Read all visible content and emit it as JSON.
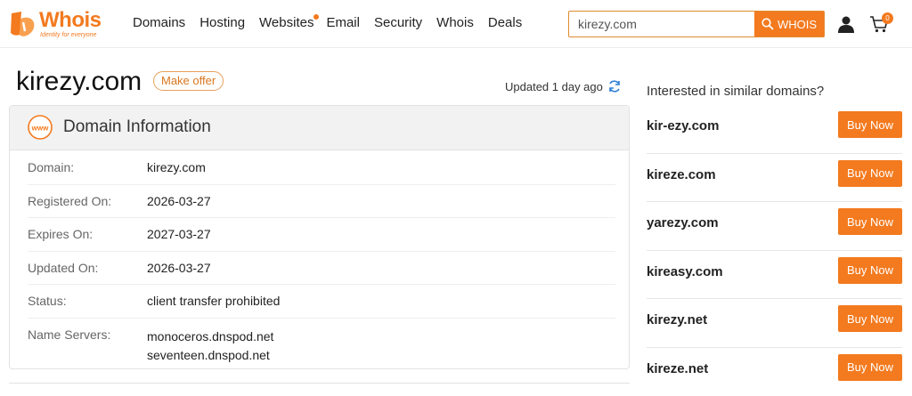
{
  "header": {
    "logo_text": "Whois",
    "logo_tagline": "Identity for everyone",
    "nav": [
      "Domains",
      "Hosting",
      "Websites",
      "Email",
      "Security",
      "Whois",
      "Deals"
    ],
    "search_value": "kirezy.com",
    "search_button": "WHOIS",
    "cart_count": "0",
    "brand_color": "#f37a1f"
  },
  "title": {
    "domain": "kirezy.com",
    "make_offer": "Make offer",
    "updated": "Updated 1 day ago"
  },
  "info": {
    "heading": "Domain Information",
    "rows": [
      {
        "label": "Domain:",
        "value": "kirezy.com"
      },
      {
        "label": "Registered On:",
        "value": "2026-03-27"
      },
      {
        "label": "Expires On:",
        "value": "2027-03-27"
      },
      {
        "label": "Updated On:",
        "value": "2026-03-27"
      },
      {
        "label": "Status:",
        "value": "client transfer prohibited"
      },
      {
        "label": "Name Servers:",
        "values": [
          "monoceros.dnspod.net",
          "seventeen.dnspod.net"
        ]
      }
    ]
  },
  "sidebar": {
    "title": "Interested in similar domains?",
    "buy_label": "Buy Now",
    "suggestions": [
      "kir-ezy.com",
      "kireze.com",
      "yarezy.com",
      "kireasy.com",
      "kirezy.net",
      "kireze.net"
    ]
  },
  "icons": {
    "search": "search-icon",
    "user": "user-icon",
    "cart": "cart-icon",
    "refresh": "refresh-icon",
    "www": "www-icon"
  }
}
